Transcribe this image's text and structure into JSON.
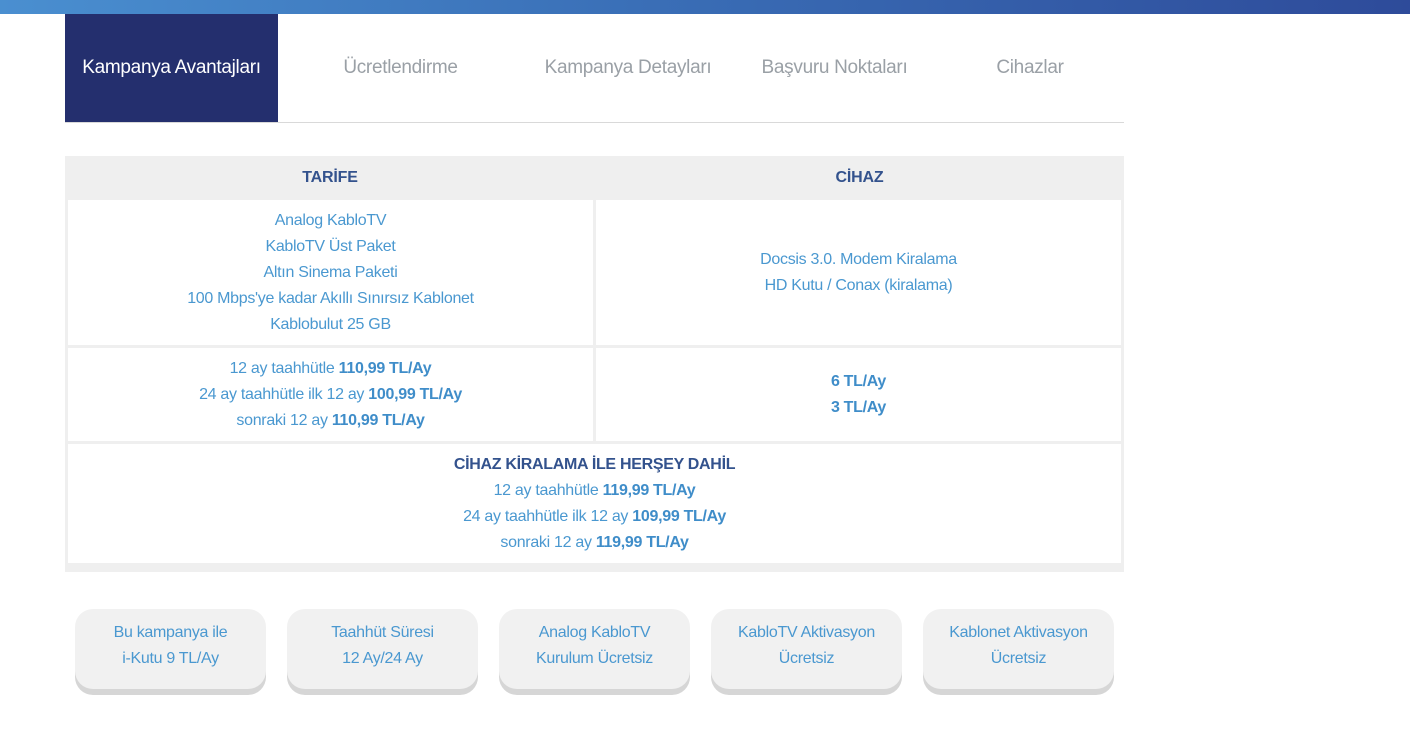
{
  "tabs": [
    {
      "label": "Kampanya Avantajları",
      "active": true
    },
    {
      "label": "Ücretlendirme",
      "active": false
    },
    {
      "label": "Kampanya Detayları",
      "active": false
    },
    {
      "label": "Başvuru Noktaları",
      "active": false
    },
    {
      "label": "Cihazlar",
      "active": false
    }
  ],
  "table": {
    "headers": {
      "tarife": "TARİFE",
      "cihaz": "CİHAZ"
    },
    "tarife_items": [
      "Analog KabloTV",
      "KabloTV Üst Paket",
      "Altın Sinema Paketi",
      "100 Mbps'ye kadar Akıllı Sınırsız Kablonet",
      "Kablobulut 25 GB"
    ],
    "cihaz_items": [
      "Docsis 3.0. Modem Kiralama",
      "HD Kutu / Conax (kiralama)"
    ],
    "tarife_prices": [
      {
        "text": "12 ay taahhütle ",
        "price": "110,99 TL/Ay"
      },
      {
        "text": "24 ay taahhütle ilk 12 ay ",
        "price": "100,99 TL/Ay"
      },
      {
        "text": "sonraki 12 ay ",
        "price": "110,99 TL/Ay"
      }
    ],
    "cihaz_prices": [
      "6 TL/Ay",
      "3 TL/Ay"
    ],
    "all_inclusive": {
      "heading": "CİHAZ KİRALAMA İLE HERŞEY DAHİL",
      "lines": [
        {
          "text": "12 ay taahhütle ",
          "price": "119,99 TL/Ay"
        },
        {
          "text": "24 ay taahhütle ilk 12 ay ",
          "price": "109,99 TL/Ay"
        },
        {
          "text": "sonraki 12 ay ",
          "price": "119,99 TL/Ay"
        }
      ]
    }
  },
  "features": [
    {
      "line1": "Bu kampanya ile",
      "line2": "i-Kutu 9 TL/Ay"
    },
    {
      "line1": "Taahhüt Süresi",
      "line2": "12 Ay/24 Ay"
    },
    {
      "line1": "Analog KabloTV",
      "line2": "Kurulum Ücretsiz"
    },
    {
      "line1": "KabloTV Aktivasyon",
      "line2": "Ücretsiz"
    },
    {
      "line1": "Kablonet Aktivasyon",
      "line2": "Ücretsiz"
    }
  ],
  "colors": {
    "active_tab_bg": "#242f6e",
    "header_text": "#33528d",
    "body_text": "#4a98d0",
    "table_bg": "#efefef"
  }
}
